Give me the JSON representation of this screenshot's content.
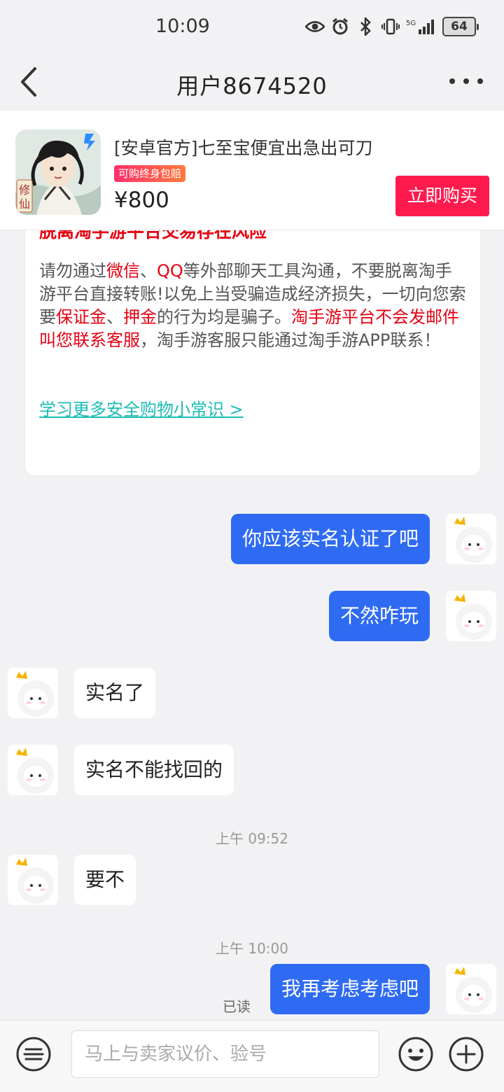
{
  "status_bar": {
    "time": "10:09",
    "battery": "64",
    "network": "5G"
  },
  "nav": {
    "title": "用户8674520"
  },
  "product": {
    "title": "[安卓官方]七至宝便宜出急出可刀",
    "badge": "可购终身包赔",
    "price": "¥800",
    "buy_label": "立即购买",
    "thumb_text": "修仙"
  },
  "notice": {
    "heading": "脱离淘手游平台交易存在风险",
    "body_parts": [
      {
        "t": "请勿通过",
        "red": false
      },
      {
        "t": "微信",
        "red": true
      },
      {
        "t": "、",
        "red": false
      },
      {
        "t": "QQ",
        "red": true
      },
      {
        "t": "等外部聊天工具沟通，不要脱离淘手游平台直接转账!以免上当受骗造成经济损失，一切向您索要",
        "red": false
      },
      {
        "t": "保证金",
        "red": true
      },
      {
        "t": "、",
        "red": false
      },
      {
        "t": "押金",
        "red": true
      },
      {
        "t": "的行为均是骗子。",
        "red": false
      },
      {
        "t": "淘手游平台不会发邮件叫您联系客服",
        "red": true
      },
      {
        "t": "，淘手游客服只能通过淘手游APP联系！",
        "red": false
      }
    ],
    "link": "学习更多安全购物小常识 >"
  },
  "messages": [
    {
      "dir": "out",
      "text": "你应该实名认证了吧"
    },
    {
      "dir": "out",
      "text": "不然咋玩"
    },
    {
      "dir": "in",
      "text": "实名了"
    },
    {
      "dir": "in",
      "text": "实名不能找回的"
    },
    {
      "dir": "in",
      "text": "要不"
    },
    {
      "dir": "out",
      "text": "我再考虑考虑吧"
    }
  ],
  "timestamps": [
    "上午 09:52",
    "上午 10:00"
  ],
  "read_label": "已读",
  "input": {
    "placeholder": "马上与卖家议价、验号"
  },
  "colors": {
    "accent_blue": "#2f6bf2",
    "buy_red": "#ff1a4d",
    "warning_red": "#e60012",
    "link_teal": "#1bbcb5"
  }
}
